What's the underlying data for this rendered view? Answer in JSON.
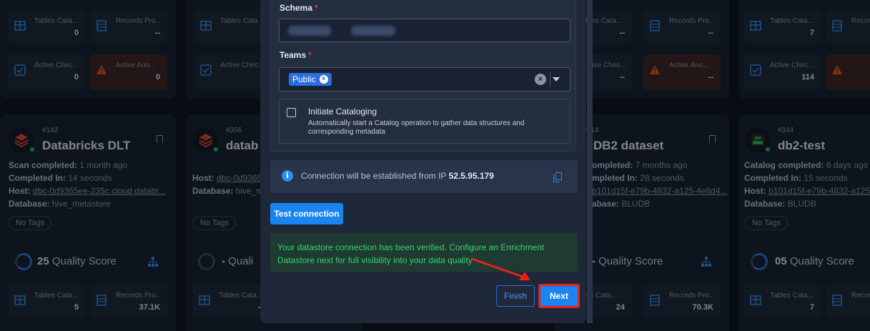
{
  "background_cards": {
    "top_row": [
      {
        "tiles": [
          {
            "label": "Tables Cata...",
            "value": "0"
          },
          {
            "label": "Records Pro...",
            "value": "--"
          },
          {
            "label": "Active Chec...",
            "value": "0"
          },
          {
            "label": "Active Ano...",
            "value": "0"
          }
        ]
      },
      {
        "tiles": [
          {
            "label": "Tables Cata...",
            "value": ""
          },
          {
            "label": "Active Chec...",
            "value": ""
          }
        ]
      },
      {
        "tiles": [
          {
            "label": "ables Cata...",
            "value": "--"
          },
          {
            "label": "Records Pro...",
            "value": "--"
          },
          {
            "label": "Active Chec...",
            "value": "--"
          },
          {
            "label": "Active Ano...",
            "value": "--"
          }
        ]
      },
      {
        "tiles": [
          {
            "label": "Tables Cata...",
            "value": "7"
          },
          {
            "label": "Records",
            "value": ""
          },
          {
            "label": "Active Chec...",
            "value": "114"
          },
          {
            "label": "",
            "value": ""
          }
        ]
      }
    ],
    "cards": [
      {
        "id": "#143",
        "title": "Databricks DLT",
        "lines": [
          [
            "Scan completed:",
            "1 month ago"
          ],
          [
            "Completed In:",
            "14 seconds"
          ],
          [
            "Host:",
            "dbc-0d9365ee-235c.cloud.databr..."
          ],
          [
            "Database:",
            "hive_metastore"
          ]
        ],
        "tag": "No Tags",
        "score": "25",
        "score_label": "Quality Score",
        "tiles": [
          {
            "label": "Tables Cata...",
            "value": "5"
          },
          {
            "label": "Records Pro...",
            "value": "37.1K"
          }
        ]
      },
      {
        "id": "#356",
        "title": "datab",
        "lines": [
          [
            "Host:",
            "dbc-0d9365"
          ],
          [
            "Database:",
            "hive_m"
          ]
        ],
        "tag": "No Tags",
        "score": "-",
        "score_label": "Quali",
        "tiles": [
          {
            "label": "Tables Cata...",
            "value": "--"
          }
        ]
      },
      {
        "id": "#114",
        "title": "DB2 dataset",
        "lines": [
          [
            "ompleted:",
            "7 months ago"
          ],
          [
            "mpleted In:",
            "28 seconds"
          ],
          [
            "",
            "b101d15f-e79b-4832-a125-4e8d4..."
          ],
          [
            "abase:",
            "BLUDB"
          ]
        ],
        "tag": "",
        "score": "-",
        "score_label": "Quality Score",
        "tiles": [
          {
            "label": "bles Cata...",
            "value": "24"
          },
          {
            "label": "Records Pro...",
            "value": "70.3K"
          }
        ]
      },
      {
        "id": "#344",
        "title": "db2-test",
        "lines": [
          [
            "Catalog completed:",
            "6 days ago"
          ],
          [
            "Completed In:",
            "15 seconds"
          ],
          [
            "Host:",
            "b101d15f-e79b-4832-a125-4e8d4..."
          ],
          [
            "Database:",
            "BLUDB"
          ]
        ],
        "tag": "No Tags",
        "score": "05",
        "score_label": "Quality Score",
        "tiles": [
          {
            "label": "Tables Cata...",
            "value": "7"
          },
          {
            "label": "Records",
            "value": ""
          }
        ]
      }
    ]
  },
  "modal": {
    "schema_label": "Schema",
    "required_mark": "*",
    "teams_label": "Teams",
    "team_chip": "Public",
    "chip_remove": "×",
    "clear_all": "×",
    "catalog_title": "Initiate Cataloging",
    "catalog_desc_1": "Automatically start a Catalog operation to gather data structures and",
    "catalog_desc_2": "corresponding metadata",
    "info_icon": "i",
    "info_text": "Connection will be established from IP",
    "ip": "52.5.95.179",
    "test_button": "Test connection",
    "success_line_1": "Your datastore connection has been verified. Configure an Enrichment",
    "success_line_2": "Datastore next for full visibility into your data quality",
    "finish_button": "Finish",
    "next_button": "Next"
  },
  "colors": {
    "primary": "#1a84f0",
    "success": "#3bd16f",
    "highlight": "#e8201a",
    "required": "#e8384f"
  }
}
